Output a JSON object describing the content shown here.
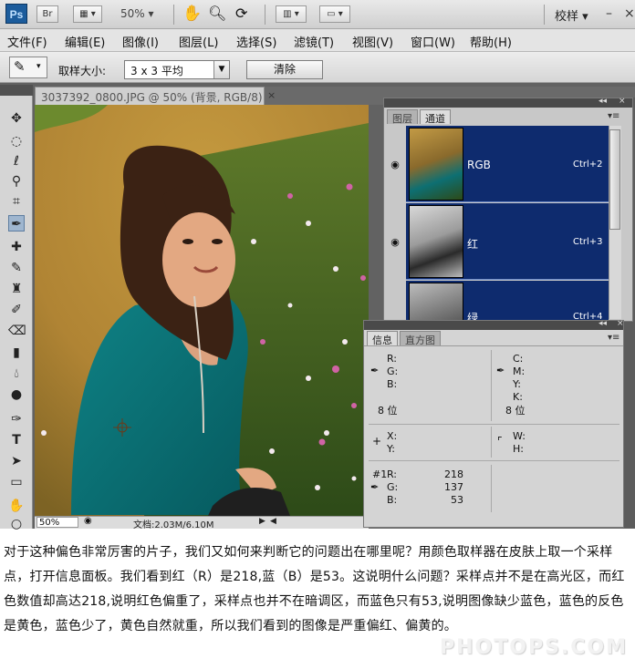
{
  "appbar": {
    "logo": "Ps",
    "bridge": "Br",
    "zoom": "50%",
    "workspace": "校样",
    "icons": [
      "hand-icon",
      "zoom-icon",
      "rotate-view-icon",
      "arrange-documents-icon",
      "screen-mode-icon"
    ]
  },
  "menu": [
    "文件(F)",
    "编辑(E)",
    "图像(I)",
    "图层(L)",
    "选择(S)",
    "滤镜(T)",
    "视图(V)",
    "窗口(W)",
    "帮助(H)"
  ],
  "options": {
    "sample_size_label": "取样大小:",
    "sample_size_value": "3 x 3 平均",
    "clear_button": "清除"
  },
  "document": {
    "tab_title": "3037392_0800.JPG @ 50% (背景, RGB/8) *",
    "close": "×",
    "status_zoom": "50%",
    "status_info": "文档:2.03M/6.10M"
  },
  "channels_panel": {
    "tabs": [
      "图层",
      "通道"
    ],
    "active_tab": "通道",
    "channels": [
      {
        "name": "RGB",
        "shortcut": "Ctrl+2"
      },
      {
        "name": "红",
        "shortcut": "Ctrl+3"
      },
      {
        "name": "绿",
        "shortcut": "Ctrl+4"
      }
    ]
  },
  "info_panel": {
    "tabs": [
      "信息",
      "直方图"
    ],
    "active_tab": "信息",
    "rgb_labels": [
      "R:",
      "G:",
      "B:"
    ],
    "cmyk_labels": [
      "C:",
      "M:",
      "Y:",
      "K:"
    ],
    "bit_depth_left": "8 位",
    "bit_depth_right": "8 位",
    "xy_labels": [
      "X:",
      "Y:"
    ],
    "wh_labels": [
      "W:",
      "H:"
    ],
    "sample_prefix": "#1",
    "sample_labels": [
      "R:",
      "G:",
      "B:"
    ],
    "sample_values": [
      "218",
      "137",
      "53"
    ]
  },
  "caption": "对于这种偏色非常厉害的片子，我们又如何来判断它的问题出在哪里呢？用颜色取样器在皮肤上取一个采样点，打开信息面板。我们看到红（R）是218,蓝（B）是53。这说明什么问题？采样点并不是在高光区，而红色数值却高达218,说明红色偏重了，采样点也并不在暗调区，而蓝色只有53,说明图像缺少蓝色，蓝色的反色是黄色，蓝色少了，黄色自然就重，所以我们看到的图像是严重偏红、偏黄的。",
  "watermark": "PHOTOPS.COM",
  "colors": {
    "channel_highlight": "#0e2b6e",
    "workspace": "#626262",
    "panel": "#d4d4d4"
  }
}
